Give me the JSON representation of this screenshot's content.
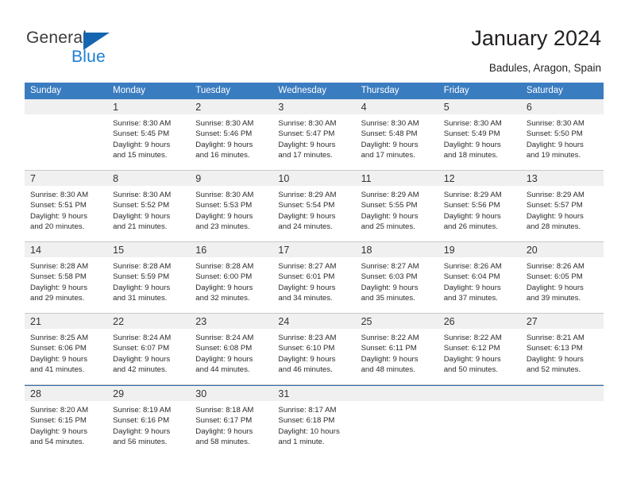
{
  "brand": {
    "name_part1": "General",
    "name_part2": "Blue",
    "accent_color": "#1b7fd4",
    "triangle_color": "#1565b0"
  },
  "header": {
    "title": "January 2024",
    "subtitle": "Badules, Aragon, Spain"
  },
  "calendar": {
    "header_bg": "#3a7cc0",
    "day_band_bg": "#f0f0f0",
    "weekdays": [
      "Sunday",
      "Monday",
      "Tuesday",
      "Wednesday",
      "Thursday",
      "Friday",
      "Saturday"
    ],
    "weeks": [
      [
        {
          "day": "",
          "sunrise": "",
          "sunset": "",
          "daylight_line1": "",
          "daylight_line2": ""
        },
        {
          "day": "1",
          "sunrise": "Sunrise: 8:30 AM",
          "sunset": "Sunset: 5:45 PM",
          "daylight_line1": "Daylight: 9 hours",
          "daylight_line2": "and 15 minutes."
        },
        {
          "day": "2",
          "sunrise": "Sunrise: 8:30 AM",
          "sunset": "Sunset: 5:46 PM",
          "daylight_line1": "Daylight: 9 hours",
          "daylight_line2": "and 16 minutes."
        },
        {
          "day": "3",
          "sunrise": "Sunrise: 8:30 AM",
          "sunset": "Sunset: 5:47 PM",
          "daylight_line1": "Daylight: 9 hours",
          "daylight_line2": "and 17 minutes."
        },
        {
          "day": "4",
          "sunrise": "Sunrise: 8:30 AM",
          "sunset": "Sunset: 5:48 PM",
          "daylight_line1": "Daylight: 9 hours",
          "daylight_line2": "and 17 minutes."
        },
        {
          "day": "5",
          "sunrise": "Sunrise: 8:30 AM",
          "sunset": "Sunset: 5:49 PM",
          "daylight_line1": "Daylight: 9 hours",
          "daylight_line2": "and 18 minutes."
        },
        {
          "day": "6",
          "sunrise": "Sunrise: 8:30 AM",
          "sunset": "Sunset: 5:50 PM",
          "daylight_line1": "Daylight: 9 hours",
          "daylight_line2": "and 19 minutes."
        }
      ],
      [
        {
          "day": "7",
          "sunrise": "Sunrise: 8:30 AM",
          "sunset": "Sunset: 5:51 PM",
          "daylight_line1": "Daylight: 9 hours",
          "daylight_line2": "and 20 minutes."
        },
        {
          "day": "8",
          "sunrise": "Sunrise: 8:30 AM",
          "sunset": "Sunset: 5:52 PM",
          "daylight_line1": "Daylight: 9 hours",
          "daylight_line2": "and 21 minutes."
        },
        {
          "day": "9",
          "sunrise": "Sunrise: 8:30 AM",
          "sunset": "Sunset: 5:53 PM",
          "daylight_line1": "Daylight: 9 hours",
          "daylight_line2": "and 23 minutes."
        },
        {
          "day": "10",
          "sunrise": "Sunrise: 8:29 AM",
          "sunset": "Sunset: 5:54 PM",
          "daylight_line1": "Daylight: 9 hours",
          "daylight_line2": "and 24 minutes."
        },
        {
          "day": "11",
          "sunrise": "Sunrise: 8:29 AM",
          "sunset": "Sunset: 5:55 PM",
          "daylight_line1": "Daylight: 9 hours",
          "daylight_line2": "and 25 minutes."
        },
        {
          "day": "12",
          "sunrise": "Sunrise: 8:29 AM",
          "sunset": "Sunset: 5:56 PM",
          "daylight_line1": "Daylight: 9 hours",
          "daylight_line2": "and 26 minutes."
        },
        {
          "day": "13",
          "sunrise": "Sunrise: 8:29 AM",
          "sunset": "Sunset: 5:57 PM",
          "daylight_line1": "Daylight: 9 hours",
          "daylight_line2": "and 28 minutes."
        }
      ],
      [
        {
          "day": "14",
          "sunrise": "Sunrise: 8:28 AM",
          "sunset": "Sunset: 5:58 PM",
          "daylight_line1": "Daylight: 9 hours",
          "daylight_line2": "and 29 minutes."
        },
        {
          "day": "15",
          "sunrise": "Sunrise: 8:28 AM",
          "sunset": "Sunset: 5:59 PM",
          "daylight_line1": "Daylight: 9 hours",
          "daylight_line2": "and 31 minutes."
        },
        {
          "day": "16",
          "sunrise": "Sunrise: 8:28 AM",
          "sunset": "Sunset: 6:00 PM",
          "daylight_line1": "Daylight: 9 hours",
          "daylight_line2": "and 32 minutes."
        },
        {
          "day": "17",
          "sunrise": "Sunrise: 8:27 AM",
          "sunset": "Sunset: 6:01 PM",
          "daylight_line1": "Daylight: 9 hours",
          "daylight_line2": "and 34 minutes."
        },
        {
          "day": "18",
          "sunrise": "Sunrise: 8:27 AM",
          "sunset": "Sunset: 6:03 PM",
          "daylight_line1": "Daylight: 9 hours",
          "daylight_line2": "and 35 minutes."
        },
        {
          "day": "19",
          "sunrise": "Sunrise: 8:26 AM",
          "sunset": "Sunset: 6:04 PM",
          "daylight_line1": "Daylight: 9 hours",
          "daylight_line2": "and 37 minutes."
        },
        {
          "day": "20",
          "sunrise": "Sunrise: 8:26 AM",
          "sunset": "Sunset: 6:05 PM",
          "daylight_line1": "Daylight: 9 hours",
          "daylight_line2": "and 39 minutes."
        }
      ],
      [
        {
          "day": "21",
          "sunrise": "Sunrise: 8:25 AM",
          "sunset": "Sunset: 6:06 PM",
          "daylight_line1": "Daylight: 9 hours",
          "daylight_line2": "and 41 minutes."
        },
        {
          "day": "22",
          "sunrise": "Sunrise: 8:24 AM",
          "sunset": "Sunset: 6:07 PM",
          "daylight_line1": "Daylight: 9 hours",
          "daylight_line2": "and 42 minutes."
        },
        {
          "day": "23",
          "sunrise": "Sunrise: 8:24 AM",
          "sunset": "Sunset: 6:08 PM",
          "daylight_line1": "Daylight: 9 hours",
          "daylight_line2": "and 44 minutes."
        },
        {
          "day": "24",
          "sunrise": "Sunrise: 8:23 AM",
          "sunset": "Sunset: 6:10 PM",
          "daylight_line1": "Daylight: 9 hours",
          "daylight_line2": "and 46 minutes."
        },
        {
          "day": "25",
          "sunrise": "Sunrise: 8:22 AM",
          "sunset": "Sunset: 6:11 PM",
          "daylight_line1": "Daylight: 9 hours",
          "daylight_line2": "and 48 minutes."
        },
        {
          "day": "26",
          "sunrise": "Sunrise: 8:22 AM",
          "sunset": "Sunset: 6:12 PM",
          "daylight_line1": "Daylight: 9 hours",
          "daylight_line2": "and 50 minutes."
        },
        {
          "day": "27",
          "sunrise": "Sunrise: 8:21 AM",
          "sunset": "Sunset: 6:13 PM",
          "daylight_line1": "Daylight: 9 hours",
          "daylight_line2": "and 52 minutes."
        }
      ],
      [
        {
          "day": "28",
          "sunrise": "Sunrise: 8:20 AM",
          "sunset": "Sunset: 6:15 PM",
          "daylight_line1": "Daylight: 9 hours",
          "daylight_line2": "and 54 minutes."
        },
        {
          "day": "29",
          "sunrise": "Sunrise: 8:19 AM",
          "sunset": "Sunset: 6:16 PM",
          "daylight_line1": "Daylight: 9 hours",
          "daylight_line2": "and 56 minutes."
        },
        {
          "day": "30",
          "sunrise": "Sunrise: 8:18 AM",
          "sunset": "Sunset: 6:17 PM",
          "daylight_line1": "Daylight: 9 hours",
          "daylight_line2": "and 58 minutes."
        },
        {
          "day": "31",
          "sunrise": "Sunrise: 8:17 AM",
          "sunset": "Sunset: 6:18 PM",
          "daylight_line1": "Daylight: 10 hours",
          "daylight_line2": "and 1 minute."
        },
        {
          "day": "",
          "sunrise": "",
          "sunset": "",
          "daylight_line1": "",
          "daylight_line2": ""
        },
        {
          "day": "",
          "sunrise": "",
          "sunset": "",
          "daylight_line1": "",
          "daylight_line2": ""
        },
        {
          "day": "",
          "sunrise": "",
          "sunset": "",
          "daylight_line1": "",
          "daylight_line2": ""
        }
      ]
    ]
  }
}
